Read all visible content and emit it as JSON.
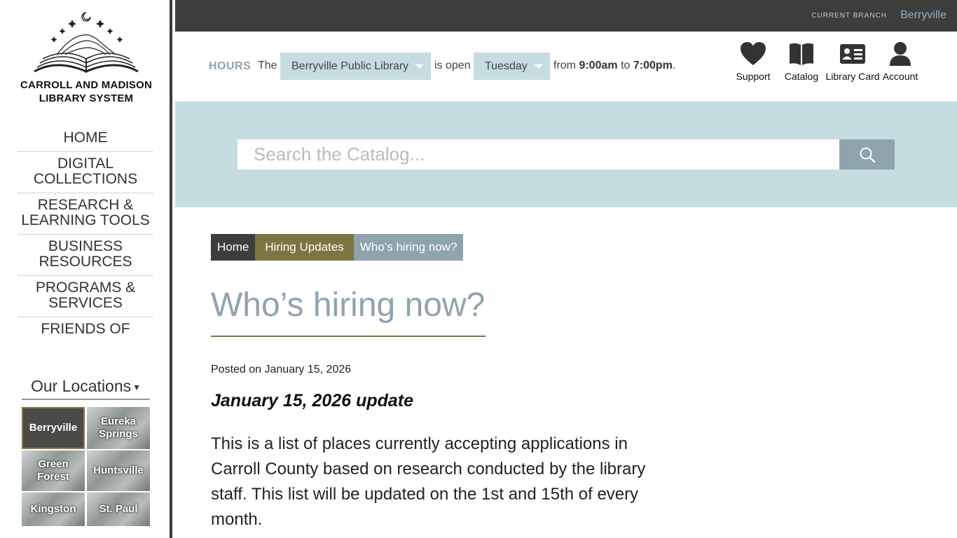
{
  "sidebar": {
    "logo_text_line1": "CARROLL AND MADISON",
    "logo_text_line2": "LIBRARY SYSTEM",
    "nav": [
      {
        "label": "HOME"
      },
      {
        "label": "DIGITAL COLLECTIONS"
      },
      {
        "label": "RESEARCH & LEARNING TOOLS"
      },
      {
        "label": "BUSINESS RESOURCES"
      },
      {
        "label": "PROGRAMS & SERVICES"
      },
      {
        "label": "FRIENDS OF"
      }
    ],
    "locations_label": "Our Locations",
    "locations": [
      {
        "label": "Berryville",
        "active": true
      },
      {
        "label": "Eureka Springs"
      },
      {
        "label": "Green Forest"
      },
      {
        "label": "Huntsville"
      },
      {
        "label": "Kingston"
      },
      {
        "label": "St. Paul"
      }
    ]
  },
  "topbar": {
    "current_branch_label": "CURRENT BRANCH",
    "current_branch_value": "Berryville"
  },
  "hours": {
    "label": "HOURS",
    "the": "The",
    "library_select": "Berryville Public Library",
    "is_open": "is open",
    "day_select": "Tuesday",
    "from": "from",
    "open_time": "9:00am",
    "to": "to",
    "close_time": "7:00pm",
    "period": "."
  },
  "quick_links": [
    {
      "label": "Support",
      "icon": "heart-icon"
    },
    {
      "label": "Catalog",
      "icon": "book-icon"
    },
    {
      "label": "Library Card",
      "icon": "id-card-icon"
    },
    {
      "label": "Account",
      "icon": "user-icon"
    }
  ],
  "search": {
    "placeholder": "Search the Catalog...",
    "icon": "search-icon"
  },
  "breadcrumb": {
    "home": "Home",
    "hiring": "Hiring Updates",
    "current": "Who’s hiring now?"
  },
  "main": {
    "title": "Who’s hiring now?",
    "posted": "Posted on January 15, 2026",
    "update_heading": "January 15, 2026 update",
    "body": "This is a list of places currently accepting applications in Carroll County based on research conducted by the library staff. This list will be updated on the 1st and 15th of every month."
  },
  "colors": {
    "accent_blue": "#8fa3ad",
    "light_blue": "#c5dde0",
    "olive": "#7e7343",
    "dark": "#3d3d3d"
  }
}
